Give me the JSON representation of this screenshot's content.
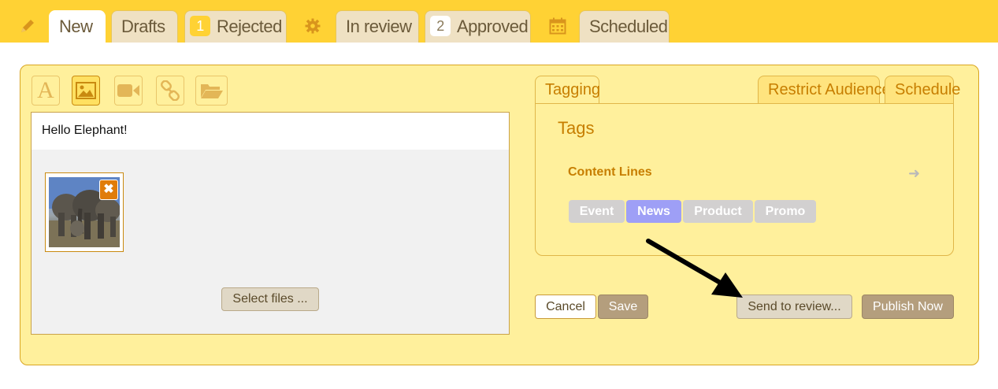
{
  "tabs": [
    {
      "label": "New",
      "active": true
    },
    {
      "label": "Drafts"
    },
    {
      "label": "Rejected",
      "count": "1"
    },
    {
      "label": "In review"
    },
    {
      "label": "Approved",
      "count": "2"
    },
    {
      "label": "Scheduled"
    }
  ],
  "topbar_icons": [
    "pencil-icon",
    "gear-icon",
    "calendar-icon"
  ],
  "toolbar": {
    "tools": [
      "text-icon",
      "image-icon",
      "video-icon",
      "link-icon",
      "folder-icon"
    ],
    "active_tool": "image-icon"
  },
  "editor": {
    "text": "Hello Elephant!",
    "remove_label": "✖",
    "select_files_label": "Select files ..."
  },
  "right_tabs": {
    "tagging": "Tagging",
    "restrict": "Restrict Audience",
    "schedule": "Schedule"
  },
  "tagging": {
    "heading": "Tags",
    "content_lines_label": "Content Lines",
    "pills": [
      "Event",
      "News",
      "Product",
      "Promo"
    ],
    "selected": "News"
  },
  "actions": {
    "cancel": "Cancel",
    "save": "Save",
    "send_review": "Send to review...",
    "publish": "Publish Now"
  },
  "colors": {
    "topbar": "#ffd234",
    "panel": "#fff09c",
    "accent": "#c77e00",
    "selected_pill": "#9e9ff6"
  }
}
